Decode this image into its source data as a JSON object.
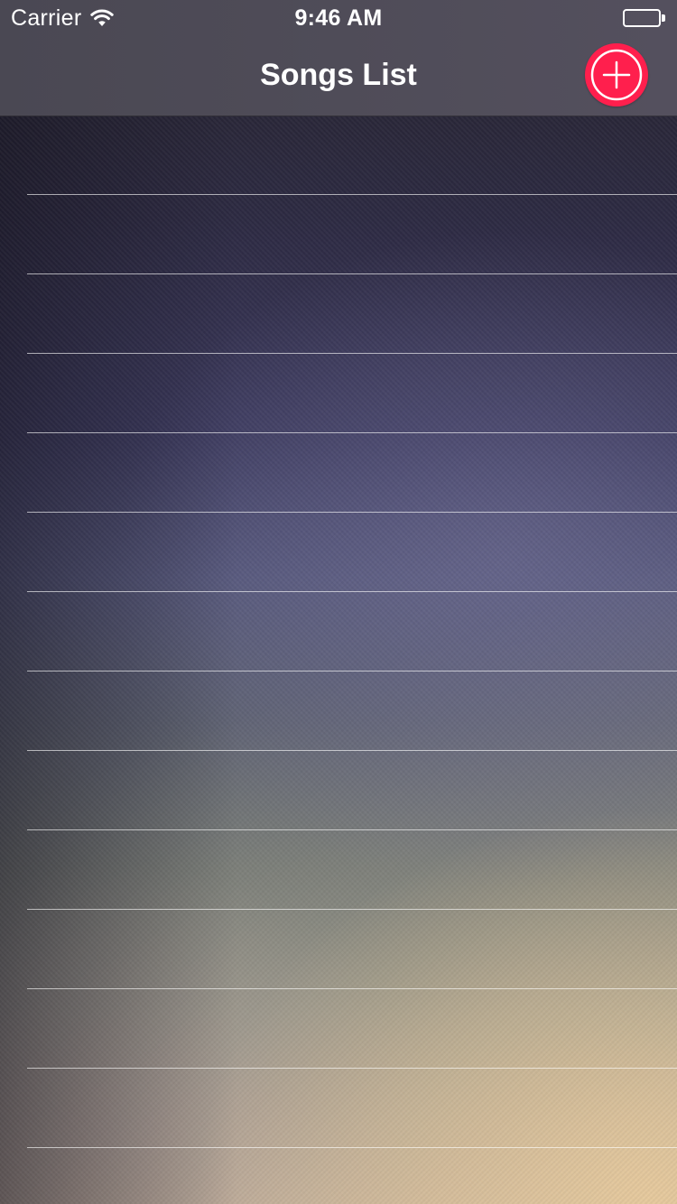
{
  "status_bar": {
    "carrier": "Carrier",
    "time": "9:46 AM",
    "wifi_icon": "wifi-icon",
    "battery_icon": "battery-icon"
  },
  "nav_bar": {
    "title": "Songs List",
    "add_button_icon": "plus-circle-icon"
  },
  "colors": {
    "accent": "#ff1f4d",
    "nav_background": "#4f4c58",
    "separator": "#ffffff"
  },
  "song_list": {
    "rows": [
      "",
      "",
      "",
      "",
      "",
      "",
      "",
      "",
      "",
      "",
      "",
      "",
      "",
      ""
    ]
  }
}
